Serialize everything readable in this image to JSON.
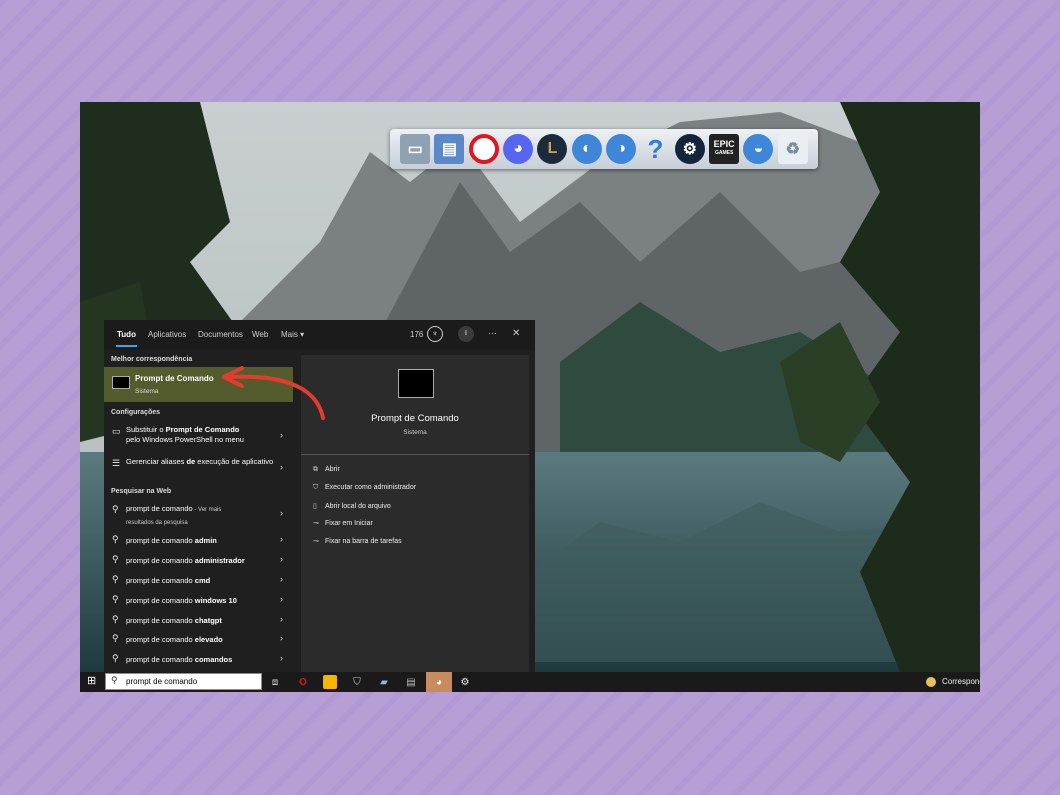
{
  "tabs": [
    "Tudo",
    "Aplicativos",
    "Documentos",
    "Web",
    "Mais ▾"
  ],
  "header": {
    "points": "176",
    "avatar_initial": "I",
    "more": "···",
    "close": "✕"
  },
  "best_match": {
    "heading": "Melhor correspondência",
    "title": "Prompt de Comando",
    "subtitle": "Sistema"
  },
  "settings": {
    "heading": "Configurações",
    "items": [
      {
        "pre": "Substituir o ",
        "bold": "Prompt de Comando",
        "post": "pelo Windows PowerShell no menu"
      },
      {
        "pre": "Gerenciar aliases ",
        "bold": "de",
        "post": " execução de aplicativo"
      }
    ]
  },
  "web": {
    "heading": "Pesquisar na Web",
    "first": {
      "text": "prompt de comando",
      "suffix": " - Ver mais",
      "line2": "resultados da pesquisa"
    },
    "items": [
      {
        "base": "prompt de comando ",
        "bold": "admin"
      },
      {
        "base": "prompt de comando ",
        "bold": "administrador"
      },
      {
        "base": "prompt de comando ",
        "bold": "cmd"
      },
      {
        "base": "prompt de comando ",
        "bold": "windows 10"
      },
      {
        "base": "prompt de comando ",
        "bold": "chatgpt"
      },
      {
        "base": "prompt de comando ",
        "bold": "elevado"
      },
      {
        "base": "prompt de comando ",
        "bold": "comandos"
      }
    ]
  },
  "detail": {
    "title": "Prompt de Comando",
    "subtitle": "Sistema",
    "actions": [
      "Abrir",
      "Executar como administrador",
      "Abrir local do arquivo",
      "Fixar em Iniciar",
      "Fixar na barra de tarefas"
    ]
  },
  "taskbar": {
    "search_value": "prompt de comando",
    "tray_text": "Correspond"
  },
  "dock": {
    "epic_label": "EPIC",
    "epic_sub": "GAMES"
  },
  "colors": {
    "highlight": "#545c2d",
    "accent": "#4aa0e6",
    "arrow": "#e53a2e",
    "background": "#b79fd6"
  }
}
